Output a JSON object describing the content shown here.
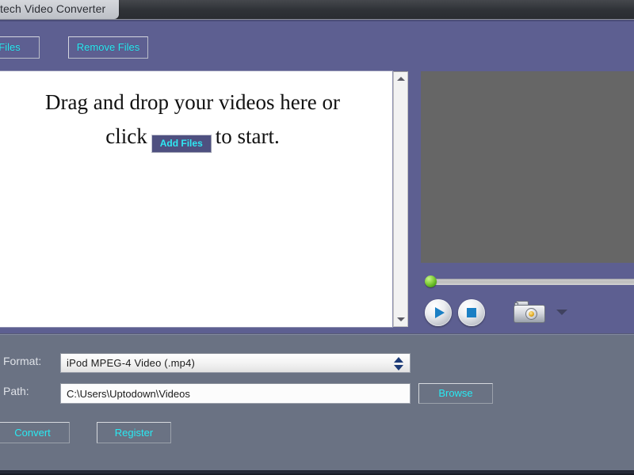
{
  "window": {
    "title": "tech Video Converter"
  },
  "toolbar": {
    "add_files_label": "Files",
    "remove_files_label": "Remove Files"
  },
  "dropzone": {
    "line1": "Drag and drop your videos here or",
    "line2_prefix": "click",
    "inline_button_label": "Add Files",
    "line2_suffix": "to start.",
    "scrollbar": {
      "up_arrow": "scroll-up-arrow",
      "down_arrow": "scroll-down-arrow"
    }
  },
  "preview": {
    "video_placeholder_color": "#666666",
    "seek_position_percent": 0,
    "play_label": "play-icon",
    "stop_label": "stop-icon",
    "snapshot_label": "camera-icon",
    "snapshot_dropdown_label": "chevron-down-icon"
  },
  "settings": {
    "format_label": "Format:",
    "format_value": "iPod MPEG-4 Video (.mp4)",
    "path_label": "Path:",
    "path_value": "C:\\Users\\Uptodown\\Videos",
    "browse_label": "Browse"
  },
  "actions": {
    "convert_label": "Convert",
    "register_label": "Register"
  },
  "colors": {
    "accent_text": "#29e9f2",
    "upper_panel": "#5d5f91",
    "lower_panel": "#6a7283",
    "titlebar": "#2f3237",
    "seek_knob": "#86d13d"
  }
}
